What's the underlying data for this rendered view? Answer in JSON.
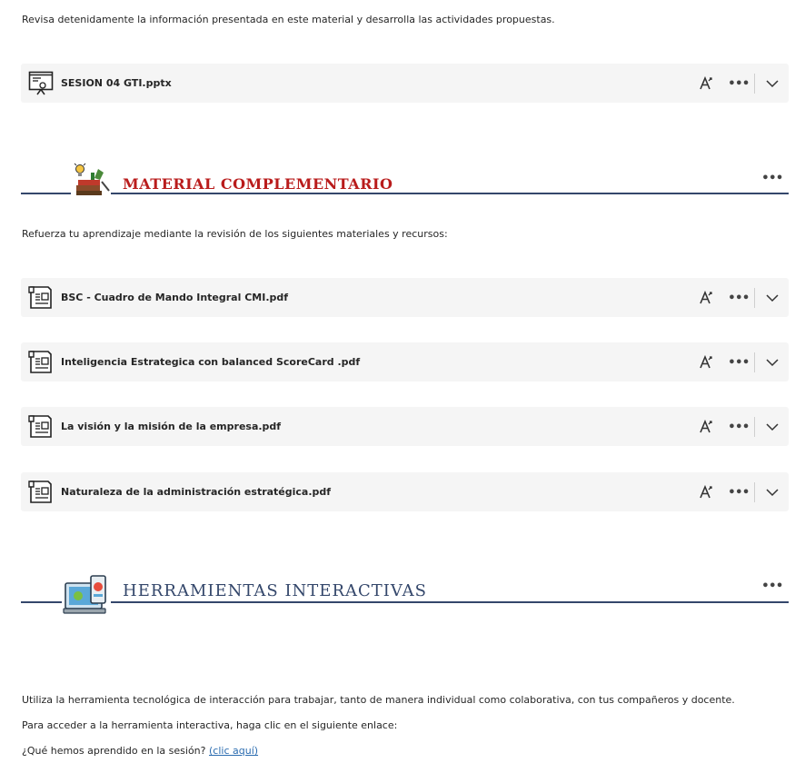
{
  "intro": {
    "text": "Revisa detenidamente la información presentada en este material y desarrolla las actividades propuestas."
  },
  "session_file": {
    "name": "SESION 04 GTI.pptx",
    "icon": "presentation-file-icon"
  },
  "material_section": {
    "title": "MATERIAL COMPLEMENTARIO",
    "title_color": "#b91c1c",
    "intro": "Refuerza tu aprendizaje mediante la revisión de los siguientes materiales y recursos:",
    "files": [
      {
        "name": "BSC - Cuadro de Mando Integral CMI.pdf",
        "icon": "document-file-icon"
      },
      {
        "name": "Inteligencia Estrategica con balanced ScoreCard .pdf",
        "icon": "document-file-icon"
      },
      {
        "name": "La visión y la misión de la empresa.pdf",
        "icon": "document-file-icon"
      },
      {
        "name": "Naturaleza de la administración estratégica.pdf",
        "icon": "document-file-icon"
      }
    ]
  },
  "tools_section": {
    "title": "HERRAMIENTAS INTERACTIVAS",
    "title_color": "#34476b",
    "para1": "Utiliza la herramienta tecnológica de interacción para trabajar, tanto de manera individual como colaborativa, con tus compañeros y docente.",
    "para2": "Para acceder a la herramienta interactiva, haga clic en el siguiente enlace:",
    "question": "¿Qué hemos aprendido en la sesión?",
    "link_label": "(clic aquí)"
  },
  "actions": {
    "more": "•••"
  },
  "colors": {
    "rule": "#34476b",
    "card_bg": "#f5f5f5",
    "link": "#2b6cb0"
  }
}
